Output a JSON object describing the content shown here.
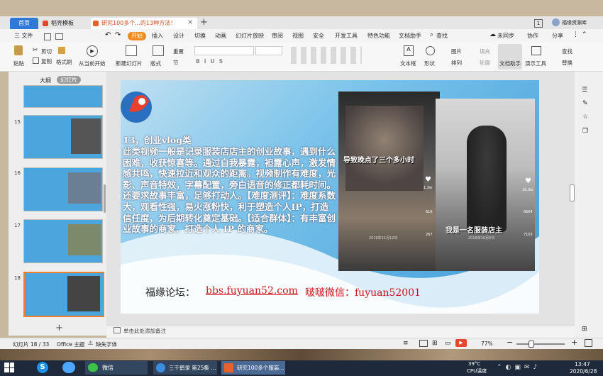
{
  "tabs": {
    "home": "首页",
    "template": "稻壳模板",
    "doc": "研究100多个...的13种方法！",
    "badge": "1",
    "account": "福缘资源库"
  },
  "menu": {
    "file": "三 文件",
    "start": "开始",
    "insert": "插入",
    "design": "设计",
    "switch": "切换",
    "animation": "动画",
    "slideshow": "幻灯片放映",
    "review": "审阅",
    "view": "视图",
    "security": "安全",
    "devtools": "开发工具",
    "special": "特色功能",
    "dochelper": "文档助手",
    "search": "查找",
    "sync": "未同步",
    "collab": "协作",
    "share": "分享"
  },
  "ribbon": {
    "paste": "粘贴",
    "cut": "剪切",
    "copy": "复制",
    "format": "格式刷",
    "from_current": "从当前开始",
    "new_slide": "新建幻灯片",
    "layout": "版式",
    "section": "节",
    "reset": "重置",
    "textbox": "文本框",
    "shape": "形状",
    "arrange": "排列",
    "image": "图片",
    "fill": "填充",
    "outline": "轮廓",
    "doc_helper": "文档助手",
    "presenter": "演示工具",
    "find": "查找",
    "replace": "替换"
  },
  "panel": {
    "outline": "大纲",
    "slides": "幻灯片"
  },
  "thumbs": [
    "15",
    "16",
    "17",
    "18"
  ],
  "slide": {
    "heading": "13，创业vlog类",
    "body": "此类视频一般是记录服装店店主的创业故事，遇到什么困难，收获惊喜等。通过自我暴露，袒露心声，激发情感共鸣，快速拉近和观众的距离。视频制作有难度，光影、声音特效，字幕配置，旁白语音的修正都耗时间。还要求故事丰富，足够打动人。【难度测评】：难度系数大，观看性强，易火涨粉快，利于塑造个人IP，打造信任度，为后期转化奠定基础。【适合群体】：有丰富创业故事的商家、打造个人 IP 的商家。",
    "forum_label": "福缘论坛：",
    "forum_url": "bbs.fuyuan52.com",
    "wechat": "  啵啵微信：fuyuan52001",
    "video_left_caption": "导致晚点了三个多小时",
    "video_right_caption": "我是一名服装店主",
    "video_left_count1": "1.3w",
    "video_left_count2": "616",
    "video_left_count3": "267",
    "video_right_count1": "16.3w",
    "video_right_count2": "6664",
    "video_right_count3": "7103",
    "video_left_date": "2019年11月12日",
    "video_right_date": "2019年10月6日"
  },
  "notes_placeholder": "单击此处添加备注",
  "status": {
    "slide_pos": "幻灯片 18 / 33",
    "theme": "Office 主题",
    "font_missing": "缺失字体",
    "zoom": "77%"
  },
  "taskbar": {
    "wechat": "微信",
    "app2": "三千鹤录 第25集 ...",
    "app3": "研究100多个服装...",
    "temp": "39°C",
    "cpu": "CPU温度",
    "time": "13:47",
    "date": "2020/6/28"
  }
}
